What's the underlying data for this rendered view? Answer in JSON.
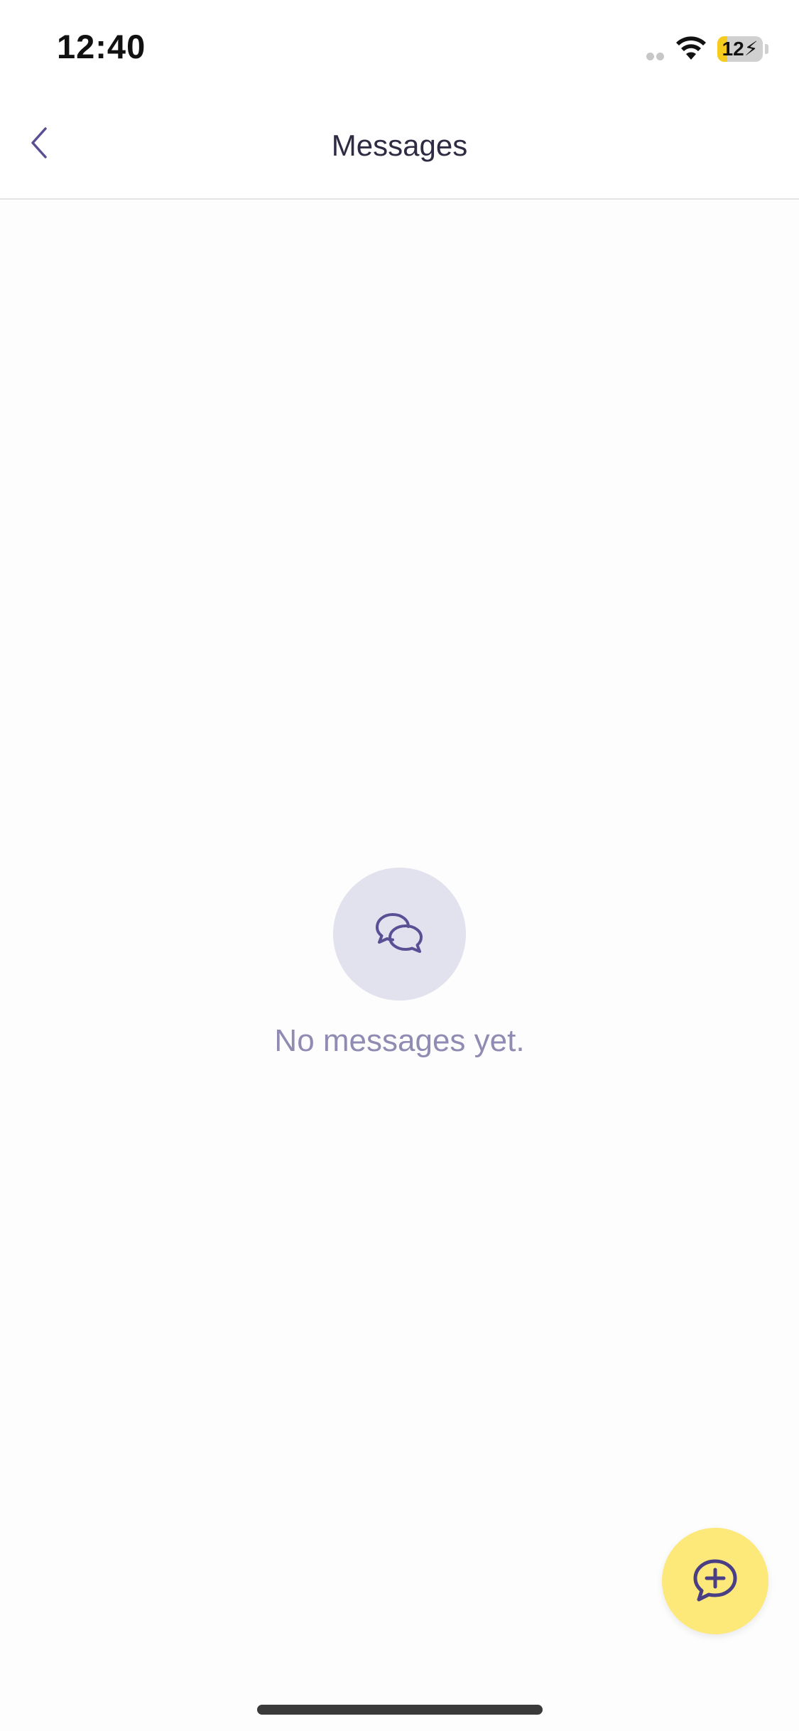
{
  "status_bar": {
    "time": "12:40",
    "battery_level": 12,
    "battery_label": "12",
    "charging": true,
    "icons": [
      "signal-icon",
      "wifi-icon",
      "battery-charging-icon"
    ]
  },
  "nav": {
    "title": "Messages",
    "back_icon": "chevron-left-icon"
  },
  "empty_state": {
    "icon": "chat-bubbles-icon",
    "message": "No messages yet."
  },
  "fab": {
    "icon": "chat-plus-icon"
  },
  "colors": {
    "accent": "#5a4f94",
    "fab_background": "#fde87a",
    "empty_circle": "#e2e1ee",
    "empty_text": "#8f8bb2",
    "battery_fill": "#f5cc1e"
  }
}
